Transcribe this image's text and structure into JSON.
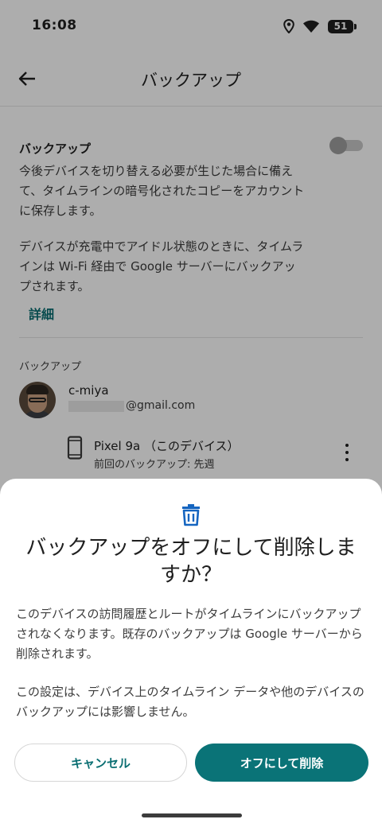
{
  "status_bar": {
    "time": "16:08",
    "battery": "51",
    "icons": [
      "location-icon",
      "wifi-icon",
      "battery-icon"
    ]
  },
  "app_bar": {
    "title": "バックアップ",
    "back_icon": "arrow-back-icon"
  },
  "backup_setting": {
    "heading": "バックアップ",
    "description_1": "今後デバイスを切り替える必要が生じた場合に備えて、タイムラインの暗号化されたコピーをアカウントに保存します。",
    "description_2": "デバイスが充電中でアイドル状態のときに、タイムラインは Wi-Fi 経由で Google サーバーにバックアップされます。",
    "details_link": "詳細",
    "toggle_on": false
  },
  "backups": {
    "section_label": "バックアップ",
    "account": {
      "name": "c-miya",
      "email": "@gmail.com"
    },
    "device": {
      "name": "Pixel 9a （このデバイス）",
      "last_backup": "前回のバックアップ: 先週"
    }
  },
  "dialog": {
    "icon": "trash-icon",
    "title": "バックアップをオフにして削除しますか？",
    "body_1": "このデバイスの訪問履歴とルートがタイムラインにバックアップされなくなります。既存のバックアップは Google サーバーから削除されます。",
    "body_2": "この設定は、デバイス上のタイムライン データや他のデバイスのバックアップには影響しません。",
    "cancel_label": "キャンセル",
    "confirm_label": "オフにして削除"
  },
  "colors": {
    "accent": "#0a7377",
    "scrim": "rgba(0,0,0,0.32)"
  }
}
